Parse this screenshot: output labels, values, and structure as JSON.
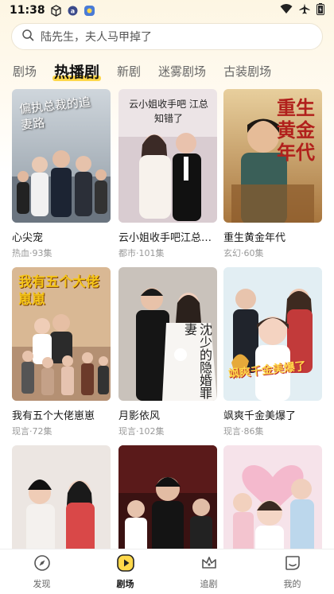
{
  "status_bar": {
    "time": "11:38",
    "icons": [
      "cube-icon",
      "alert-icon",
      "app-icon",
      "wifi-icon",
      "airplane-icon",
      "battery-icon"
    ]
  },
  "search": {
    "placeholder": "陆先生，夫人马甲掉了"
  },
  "tabs": [
    {
      "label": "剧场",
      "active": false
    },
    {
      "label": "热播剧",
      "active": true
    },
    {
      "label": "新剧",
      "active": false
    },
    {
      "label": "迷雾剧场",
      "active": false
    },
    {
      "label": "古装剧场",
      "active": false
    }
  ],
  "dramas": [
    {
      "title": "心尖宠",
      "meta": "热血·93集",
      "poster_text": "偏执总裁的追妻路"
    },
    {
      "title": "云小姐收手吧江总知错了",
      "meta": "都市·101集",
      "poster_text": "云小姐收手吧 江总知错了"
    },
    {
      "title": "重生黄金年代",
      "meta": "玄幻·60集",
      "poster_text": "重生 黄金年代"
    },
    {
      "title": "我有五个大佬崽崽",
      "meta": "现言·72集",
      "poster_text": "我有五个大佬崽崽"
    },
    {
      "title": "月影依风",
      "meta": "现言·102集",
      "poster_text": "沈少的隐婚罪妻"
    },
    {
      "title": "飒爽千金美爆了",
      "meta": "现言·86集",
      "poster_text": "飒爽千金美爆了"
    },
    {
      "title": "",
      "meta": "",
      "poster_text": ""
    },
    {
      "title": "",
      "meta": "",
      "poster_text": ""
    },
    {
      "title": "",
      "meta": "",
      "poster_text": ""
    }
  ],
  "bottom_nav": [
    {
      "label": "发现",
      "icon": "compass-icon",
      "active": false
    },
    {
      "label": "剧场",
      "icon": "play-icon",
      "active": true
    },
    {
      "label": "追剧",
      "icon": "crown-icon",
      "active": false
    },
    {
      "label": "我的",
      "icon": "profile-icon",
      "active": false
    }
  ],
  "colors": {
    "accent": "#ffd84a",
    "background_top": "#fdf6e3"
  }
}
